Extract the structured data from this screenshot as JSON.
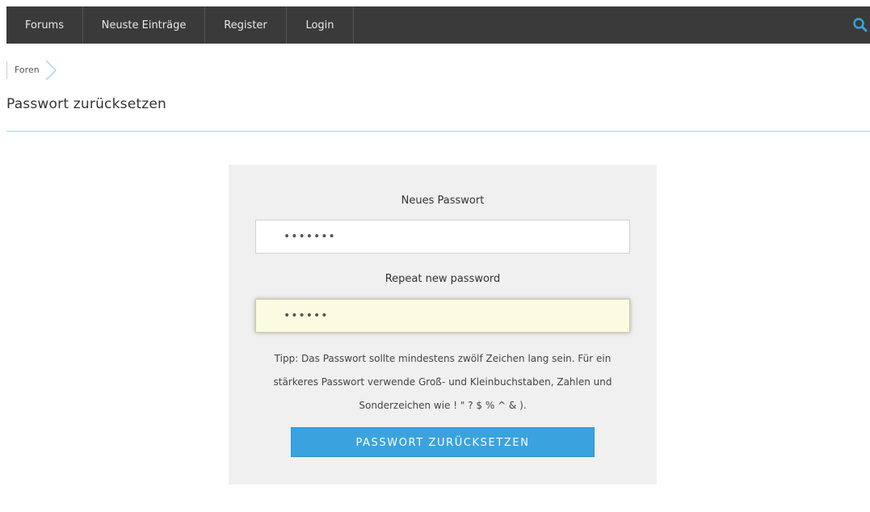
{
  "nav": {
    "items": [
      {
        "label": "Forums"
      },
      {
        "label": "Neuste Einträge"
      },
      {
        "label": "Register"
      },
      {
        "label": "Login"
      }
    ],
    "search_icon": "search-icon",
    "search_icon_color": "#3aa3df"
  },
  "breadcrumb": {
    "items": [
      {
        "label": "Foren"
      }
    ]
  },
  "page": {
    "title": "Passwort zurücksetzen"
  },
  "form": {
    "new_password_label": "Neues Passwort",
    "new_password_value": "•••••••",
    "repeat_password_label": "Repeat new password",
    "repeat_password_value": "••••••",
    "tip_lines": [
      "Tipp: Das Passwort sollte mindestens zwölf Zeichen lang sein. Für ein",
      "stärkeres Passwort verwende Groß- und Kleinbuchstaben, Zahlen und",
      "Sonderzeichen wie ! \" ? $ % ^ & )."
    ],
    "submit_label": "PASSWORT ZURÜCKSETZEN"
  },
  "colors": {
    "navbar_bg": "#3a3a3a",
    "accent": "#3aa3df",
    "panel_bg": "#f0f0f0",
    "focused_input_bg": "#fbfbe2"
  }
}
